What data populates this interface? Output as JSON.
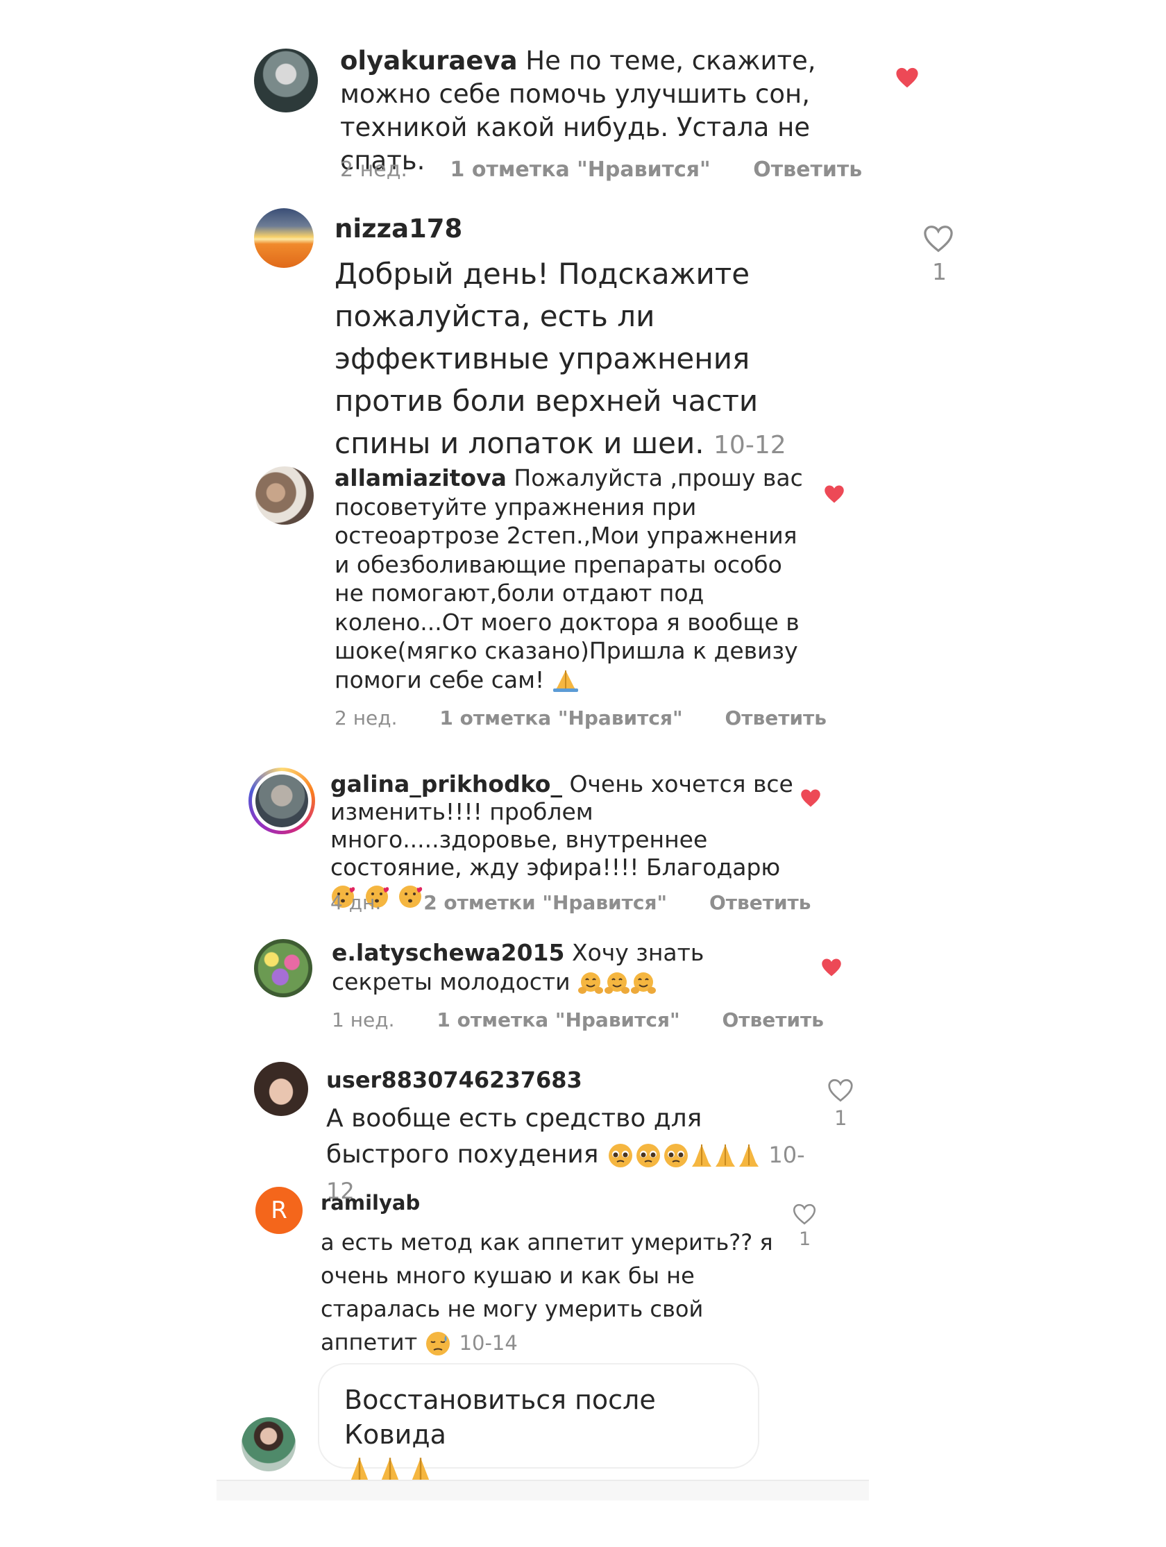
{
  "comments": [
    {
      "username": "olyakuraeva",
      "text": "Не по теме, скажите, можно себе помочь улучшить сон, техникой какой нибудь. Устала не спать.",
      "time": "2 нед.",
      "likes": "1 отметка \"Нравится\"",
      "reply": "Ответить",
      "liked": true
    },
    {
      "username": "nizza178",
      "text": "Добрый день! Подскажите пожалуйста, есть ли эффективные упражнения против боли верхней части спины и лопаток и шеи.",
      "timestamp": "10-12",
      "like_count": "1",
      "liked": false
    },
    {
      "username": "allamiazitova",
      "text": "Пожалуйста ,прошу вас посоветуйте упражнения при остеоартрозе 2степ.,Мои упражнения и обезболивающие препараты особо не помогают,боли отдают под колено...От моего доктора я вообще в шоке(мягко сказано)Пришла к девизу помоги себе сам!",
      "time": "2 нед.",
      "likes": "1 отметка \"Нравится\"",
      "reply": "Ответить",
      "liked": true
    },
    {
      "username": "galina_prikhodko_",
      "text": "Очень хочется все изменить!!!! проблем много.....здоровье, внутреннее состояние, жду эфира!!!! Благодарю",
      "time": "4 дн.",
      "likes": "2 отметки \"Нравится\"",
      "reply": "Ответить",
      "liked": true
    },
    {
      "username": "e.latyschewa2015",
      "text": "Хочу знать секреты молодости",
      "time": "1 нед.",
      "likes": "1 отметка \"Нравится\"",
      "reply": "Ответить",
      "liked": true
    },
    {
      "username": "user8830746237683",
      "text": "А вообще есть средство для быстрого похудения",
      "timestamp": "10-12",
      "like_count": "1",
      "liked": false
    },
    {
      "username": "ramilyab",
      "avatar_letter": "R",
      "text": "а есть метод как аппетит умерить?? я очень много кушаю и как бы не старалась не могу умерить свой аппетит",
      "timestamp": "10-14",
      "like_count": "1",
      "liked": false
    },
    {
      "text": "Восстановиться после Ковида"
    }
  ],
  "colors": {
    "heart": "#ed4956",
    "accent_avatar_r": "#f4661b",
    "meta": "#8e8e8e",
    "text": "#262626"
  },
  "icons": [
    "heart-filled-icon",
    "heart-outline-icon"
  ]
}
